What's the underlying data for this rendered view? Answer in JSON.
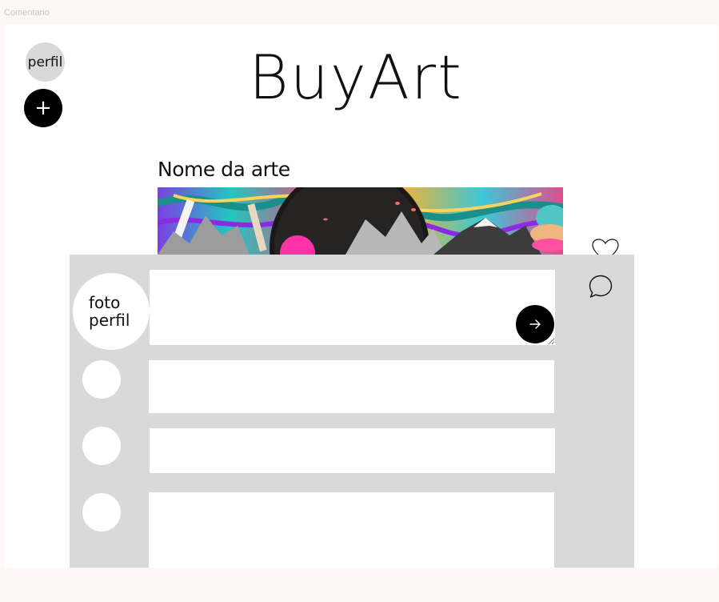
{
  "frame_label": "Comentario",
  "nav": {
    "profile_label": "perfil",
    "add_label": "+"
  },
  "brand": {
    "title": "BuyArt"
  },
  "art": {
    "name": "Nome da arte"
  },
  "icons": {
    "like": "heart-icon",
    "comment": "chat-bubble-icon",
    "send": "arrow-right-icon",
    "add": "plus-icon"
  },
  "composer": {
    "avatar_line1": "foto",
    "avatar_line2": "perfil",
    "value": "",
    "placeholder": ""
  },
  "comments": [
    {
      "text": ""
    },
    {
      "text": ""
    },
    {
      "text": ""
    }
  ],
  "colors": {
    "page_background": "#fdf8f6",
    "frame_background": "#ffffff",
    "panel_gray": "#d9d9d9",
    "button_black": "#000000"
  }
}
